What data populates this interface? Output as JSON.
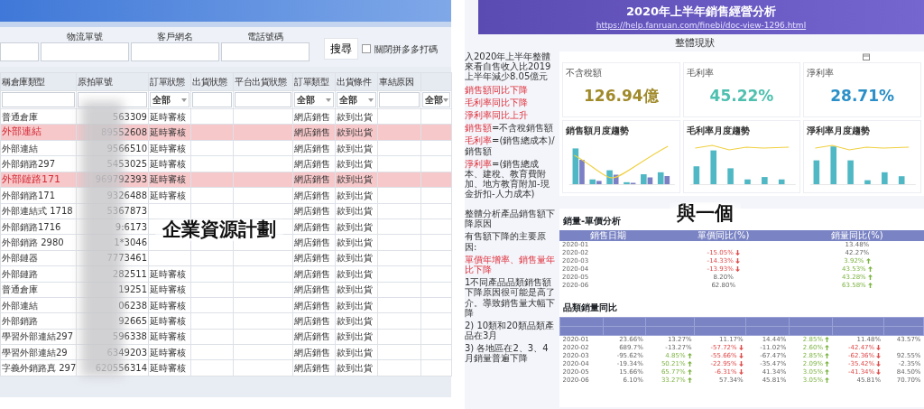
{
  "erp_window": {
    "filters": [
      "物流單號",
      "客戶網名",
      "電話號碼"
    ],
    "search_button": "搜尋",
    "option": {
      "label": "關閉拼多多打碼",
      "checked": false
    },
    "columns": [
      "稱倉庫類型",
      "原拍單號",
      "訂單狀態",
      "出貨狀態",
      "平台出貨狀態",
      "訂單類型",
      "出貨條件",
      "車結原因"
    ],
    "column_filters": [
      {
        "kind": "field"
      },
      {
        "kind": "field"
      },
      {
        "kind": "dropdown",
        "value": "全部"
      },
      {
        "kind": "field"
      },
      {
        "kind": "field"
      },
      {
        "kind": "dropdown",
        "value": "全部"
      },
      {
        "kind": "dropdown",
        "value": "全部"
      },
      {
        "kind": "field"
      },
      {
        "kind": "dropdown",
        "value": "全部"
      }
    ],
    "rows": [
      {
        "warehouse": "普通倉庫",
        "order_no": "563309",
        "status": "延時審核",
        "order_type": "網店銷售",
        "condition": "款到出貨",
        "highlighted": false
      },
      {
        "warehouse": "外部連結",
        "order_no": "89552608",
        "status": "延時審核",
        "order_type": "網店銷售",
        "condition": "款到出貨",
        "highlighted": true
      },
      {
        "warehouse": "外部連結",
        "order_no": "9566510",
        "status": "延時審核",
        "order_type": "網店銷售",
        "condition": "款到出貨",
        "highlighted": false
      },
      {
        "warehouse": "外部銷路297",
        "order_no": "5453025",
        "status": "延時審核",
        "order_type": "網店銷售",
        "condition": "款到出貨",
        "highlighted": false
      },
      {
        "warehouse": "外部鏈路171",
        "order_no": "969792393",
        "status": "延時審核",
        "order_type": "網店銷售",
        "condition": "款到出貨",
        "highlighted": true
      },
      {
        "warehouse": "外部銷路171",
        "order_no": "9326488",
        "status": "延時審核",
        "order_type": "網店銷售",
        "condition": "款到出貨",
        "highlighted": false
      },
      {
        "warehouse": "外部連結式 1718",
        "order_no": "5367873",
        "order_type": "網店銷售",
        "condition": "款到出貨",
        "highlighted": false
      },
      {
        "warehouse": "外部銷路1716",
        "order_no": "9:6173",
        "order_type": "網店銷售",
        "condition": "款到出貨",
        "highlighted": false
      },
      {
        "warehouse": "外部銷路 2980",
        "order_no": "1*3046",
        "order_type": "網店銷售",
        "condition": "款到出貨",
        "highlighted": false
      },
      {
        "warehouse": "外部鏈器",
        "order_no": "7773461",
        "order_type": "網店銷售",
        "condition": "款到出貨",
        "highlighted": false
      },
      {
        "warehouse": "外部鏈路",
        "order_no": "282511",
        "status": "延時審核",
        "order_type": "網店銷售",
        "condition": "款到出貨",
        "highlighted": false
      },
      {
        "warehouse": "普通倉庫",
        "order_no": "19251",
        "status": "延時審核",
        "order_type": "網店銷售",
        "condition": "款到出貨",
        "highlighted": false
      },
      {
        "warehouse": "外部連結",
        "order_no": "06238",
        "status": "延時審核",
        "order_type": "網店銷售",
        "condition": "款到出貨",
        "highlighted": false
      },
      {
        "warehouse": "外部銷路",
        "order_no": "92665",
        "status": "延時審核",
        "order_type": "網店銷售",
        "condition": "款到出貨",
        "highlighted": false
      },
      {
        "warehouse": "學習外部連結297",
        "order_no": "596338",
        "status": "延時審核",
        "order_type": "網店銷售",
        "condition": "款到出貨",
        "highlighted": false
      },
      {
        "warehouse": "學習外部連結29",
        "order_no": "6349203",
        "status": "延時審核",
        "order_type": "網店銷售",
        "condition": "款到出貨",
        "highlighted": false
      },
      {
        "warehouse": "字義外銷路真 297",
        "order_no": "620556314",
        "status": "延時審核",
        "order_type": "網店銷售",
        "condition": "款到出貨",
        "highlighted": false
      }
    ]
  },
  "captions": [
    "企業資源計劃",
    "與一個"
  ],
  "dashboard": {
    "title": "2020年上半年銷售經營分析",
    "subtitle_link": "https://help.fanruan.com/finebi/doc-view-1296.html",
    "section_title": "整體現狀",
    "summary_note": [
      {
        "kind": "plain",
        "text": "入2020年上半年整體來看自售收入比2019上半年減少8.05億元"
      },
      {
        "kind": "alert",
        "text": "銷售額同比下降"
      },
      {
        "kind": "alert",
        "text": "毛利率同比下降"
      },
      {
        "kind": "alert",
        "text": "淨利率同比上升"
      },
      {
        "kind": "formula",
        "label": "銷售額",
        "text": "=不含稅銷售額"
      },
      {
        "kind": "formula",
        "label": "毛利率",
        "text": "=(銷售總成本)/銷售額"
      },
      {
        "kind": "formula",
        "label": "淨利率",
        "text": "=(銷售總成本、建稅、教育費附加、地方教育附加-現金折扣-人力成本)"
      }
    ],
    "kpis": [
      {
        "label": "不含稅額",
        "value": "126.94億",
        "color": "#a08a2a"
      },
      {
        "label": "毛利率",
        "value": "45.22%",
        "color": "#4fc0b0"
      },
      {
        "label": "淨利率",
        "value": "28.71%",
        "color": "#2b8fc8"
      }
    ],
    "trend_charts": [
      "銷售額月度趨勢",
      "毛利率月度趨勢",
      "淨利率月度趨勢"
    ],
    "cause_note": [
      {
        "kind": "plain",
        "text": "整體分析產品銷售額下降原因"
      },
      {
        "kind": "plain",
        "text": "有售額下降的主要原因:"
      },
      {
        "kind": "alert",
        "text": "單價年增率、銷售量年比下降"
      },
      {
        "kind": "plain",
        "text": "1不同產品品類銷售額下降原因很可能是高了介。導致銷售量大幅下降"
      },
      {
        "kind": "plain",
        "text": "2) 10類和20類品類產品在3月"
      },
      {
        "kind": "plain",
        "text": "3) 各地區在2、3、4月銷量普遍下降"
      }
    ],
    "price_volume_table": {
      "title": "銷量-單價分析",
      "columns": [
        "銷售日期",
        "單價同比(%)",
        "銷量同比(%)"
      ],
      "rows": [
        {
          "cells": [
            {
              "text": "2020-01"
            },
            {
              "text": ""
            },
            {
              "text": "13.48%"
            }
          ]
        },
        {
          "cells": [
            {
              "text": "2020-02"
            },
            {
              "text": "-15.05%",
              "arrow_down": true
            },
            {
              "text": "42.27%"
            }
          ]
        },
        {
          "cells": [
            {
              "text": "2020-03"
            },
            {
              "text": "-14.33%",
              "arrow_down": true
            },
            {
              "text": "3.92%",
              "arrow_up": true
            }
          ]
        },
        {
          "cells": [
            {
              "text": "2020-04"
            },
            {
              "text": "-13.93%",
              "arrow_down": true
            },
            {
              "text": "43.53%",
              "arrow_up": true
            }
          ]
        },
        {
          "cells": [
            {
              "text": "2020-05"
            },
            {
              "text": "8.20%"
            },
            {
              "text": "43.28%",
              "arrow_up": true
            }
          ]
        },
        {
          "cells": [
            {
              "text": "2020-06"
            },
            {
              "text": "62.80%"
            },
            {
              "text": "63.58%",
              "arrow_up": true
            }
          ]
        }
      ]
    },
    "category_table": {
      "title": "品類銷量同比",
      "rows": [
        {
          "cells": [
            {
              "text": "2020-01"
            },
            {
              "text": "23.66%"
            },
            {
              "text": "13.27%"
            },
            {
              "text": "11.17%"
            },
            {
              "text": "14.44%"
            },
            {
              "text": "2.85%",
              "arrow_up": true
            },
            {
              "text": "11.48%"
            },
            {
              "text": "43.57%"
            }
          ]
        },
        {
          "cells": [
            {
              "text": "2020-02"
            },
            {
              "text": "689.7%"
            },
            {
              "text": "-13.27%"
            },
            {
              "text": "-57.72%",
              "arrow_down": true
            },
            {
              "text": "-11.02%"
            },
            {
              "text": "2.60%",
              "arrow_up": true
            },
            {
              "text": "-42.47%",
              "arrow_down": true
            },
            {
              "text": ""
            }
          ]
        },
        {
          "cells": [
            {
              "text": "2020-03"
            },
            {
              "text": "-95.62%"
            },
            {
              "text": "4.85%",
              "arrow_up": true
            },
            {
              "text": "-55.66%",
              "arrow_down": true
            },
            {
              "text": "-67.47%"
            },
            {
              "text": "2.85%",
              "arrow_up": true
            },
            {
              "text": "-62.36%",
              "arrow_down": true
            },
            {
              "text": "92.55%"
            }
          ]
        },
        {
          "cells": [
            {
              "text": "2020-04"
            },
            {
              "text": "-19.34%"
            },
            {
              "text": "50.21%",
              "arrow_up": true
            },
            {
              "text": "-22.95%",
              "arrow_down": true
            },
            {
              "text": "-35.47%"
            },
            {
              "text": "2.09%",
              "arrow_up": true
            },
            {
              "text": "-35.42%",
              "arrow_down": true
            },
            {
              "text": "-2.35%"
            }
          ]
        },
        {
          "cells": [
            {
              "text": "2020-05"
            },
            {
              "text": "15.66%"
            },
            {
              "text": "65.77%",
              "arrow_up": true
            },
            {
              "text": "-6.31%",
              "arrow_down": true
            },
            {
              "text": "41.34%"
            },
            {
              "text": "3.05%",
              "arrow_up": true
            },
            {
              "text": "-41.34%",
              "arrow_down": true
            },
            {
              "text": "84.50%"
            }
          ]
        },
        {
          "cells": [
            {
              "text": "2020-06"
            },
            {
              "text": "6.10%"
            },
            {
              "text": "33.27%",
              "arrow_up": true
            },
            {
              "text": "57.34%"
            },
            {
              "text": "45.81%"
            },
            {
              "text": "3.05%",
              "arrow_up": true
            },
            {
              "text": "45.81%"
            },
            {
              "text": "70.70%"
            }
          ]
        }
      ]
    }
  }
}
